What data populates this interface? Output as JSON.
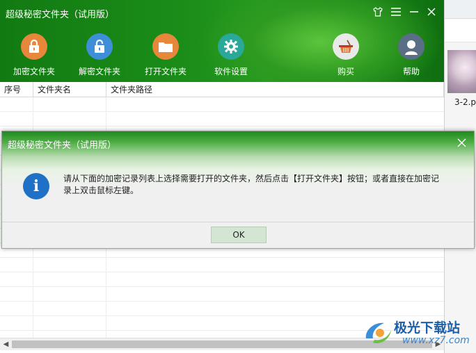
{
  "app": {
    "title": "超级秘密文件夹（试用版）",
    "toolbar": [
      {
        "label": "加密文件夹",
        "icon": "lock-closed-icon",
        "color": "#e7873c"
      },
      {
        "label": "解密文件夹",
        "icon": "lock-open-icon",
        "color": "#3f8fd8"
      },
      {
        "label": "打开文件夹",
        "icon": "folder-icon",
        "color": "#e7873c"
      },
      {
        "label": "软件设置",
        "icon": "gear-icon",
        "color": "#2aa89a"
      },
      {
        "label": "购买",
        "icon": "basket-icon",
        "color": "#e9e9e9"
      },
      {
        "label": "帮助",
        "icon": "user-help-icon",
        "color": "#5a6e86"
      }
    ],
    "table": {
      "columns": [
        "序号",
        "文件夹名",
        "文件夹路径"
      ],
      "rows": []
    }
  },
  "dialog": {
    "title": "超级秘密文件夹（试用版）",
    "message": "请从下面的加密记录列表上选择需要打开的文件夹，然后点击【打开文件夹】按钮；或者直接在加密记录上双击鼠标左键。",
    "ok_label": "OK"
  },
  "background_window": {
    "file_label": "3-2.p"
  },
  "watermark": {
    "text": "极光下载站",
    "url": "www.xz7.com"
  }
}
